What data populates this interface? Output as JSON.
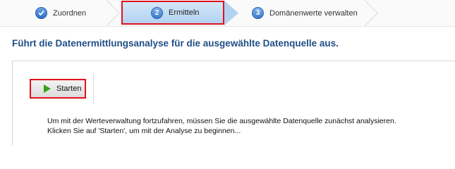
{
  "wizard": {
    "steps": [
      {
        "number": "1",
        "label": "Zuordnen",
        "state": "completed",
        "icon": "checkmark-icon"
      },
      {
        "number": "2",
        "label": "Ermitteln",
        "state": "active"
      },
      {
        "number": "3",
        "label": "Domänenwerte verwalten",
        "state": "pending"
      }
    ]
  },
  "page": {
    "title": "Führt die Datenermittlungsanalyse für die ausgewählte Datenquelle aus."
  },
  "toolbar": {
    "start_label": "Starten",
    "start_icon": "play-icon"
  },
  "info": {
    "line1": "Um mit der Werteverwaltung fortzufahren, müssen Sie die ausgewählte Datenquelle zunächst analysieren.",
    "line2": "Klicken Sie auf 'Starten', um mit der Analyse zu beginnen..."
  },
  "colors": {
    "title": "#1f4f86",
    "highlight": "#e0121b",
    "active_step": "#b3d3f1"
  }
}
